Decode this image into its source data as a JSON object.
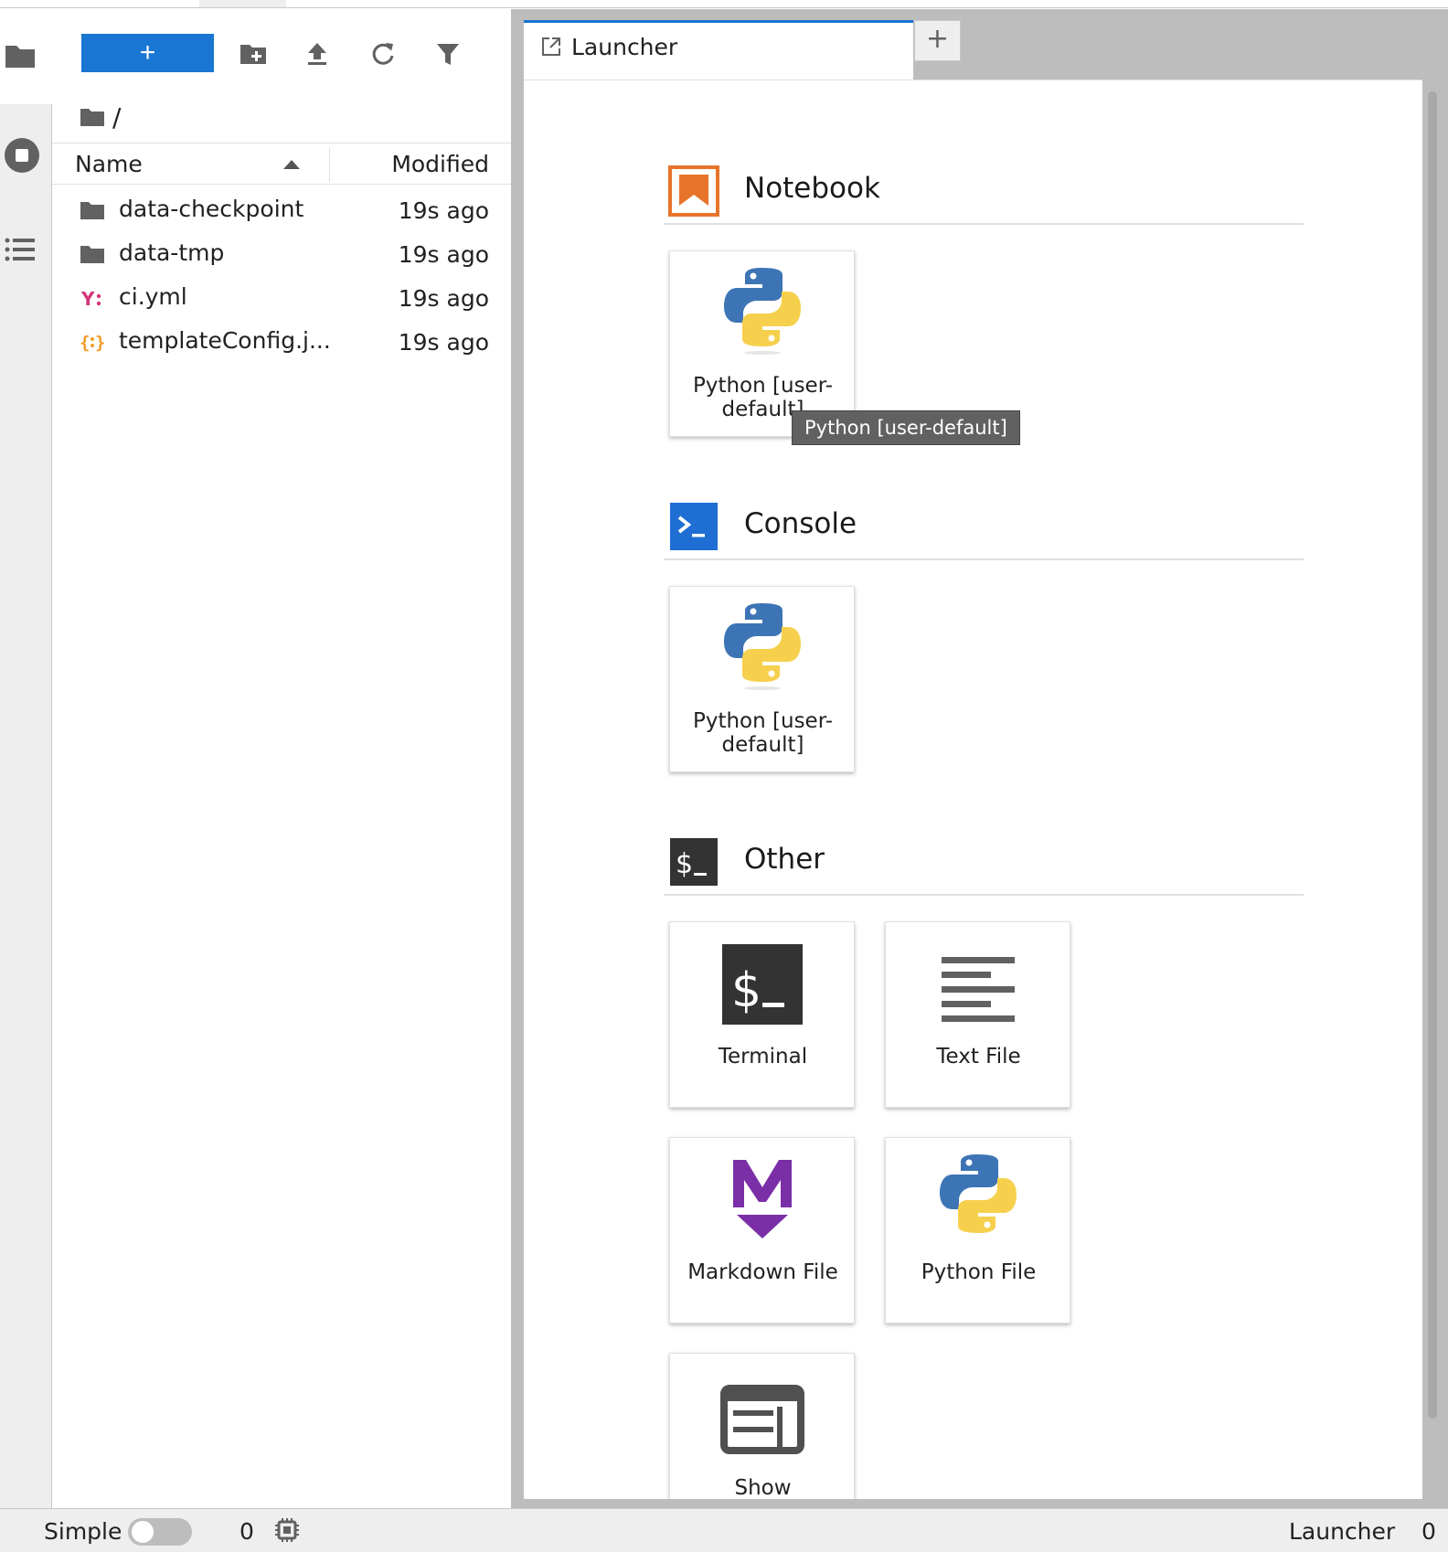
{
  "file_browser": {
    "new_label": "+",
    "breadcrumb": "/",
    "columns": {
      "name": "Name",
      "modified": "Modified"
    },
    "files": [
      {
        "name": "data-checkpoint",
        "modified": "19s ago",
        "type": "folder"
      },
      {
        "name": "data-tmp",
        "modified": "19s ago",
        "type": "folder"
      },
      {
        "name": "ci.yml",
        "modified": "19s ago",
        "type": "yaml"
      },
      {
        "name": "templateConfig.j...",
        "modified": "19s ago",
        "type": "json"
      }
    ]
  },
  "tabs": {
    "active": "Launcher",
    "add_label": "+"
  },
  "launcher": {
    "sections": {
      "notebook": "Notebook",
      "console": "Console",
      "other": "Other"
    },
    "cards": {
      "notebook_python": "Python [user-default]",
      "console_python": "Python [user-default]",
      "terminal": "Terminal",
      "text_file": "Text File",
      "markdown_file": "Markdown File",
      "python_file": "Python File",
      "show": "Show"
    },
    "tooltip": "Python [user-default]"
  },
  "statusbar": {
    "mode": "Simple",
    "kernel_count": "0",
    "right_label": "Launcher",
    "right_count": "0"
  },
  "colors": {
    "accent": "#1976d2",
    "notebook_orange": "#e8742c",
    "markdown_purple": "#7b2fa7",
    "yaml_pink": "#d2367a",
    "json_orange": "#f09d2a"
  }
}
